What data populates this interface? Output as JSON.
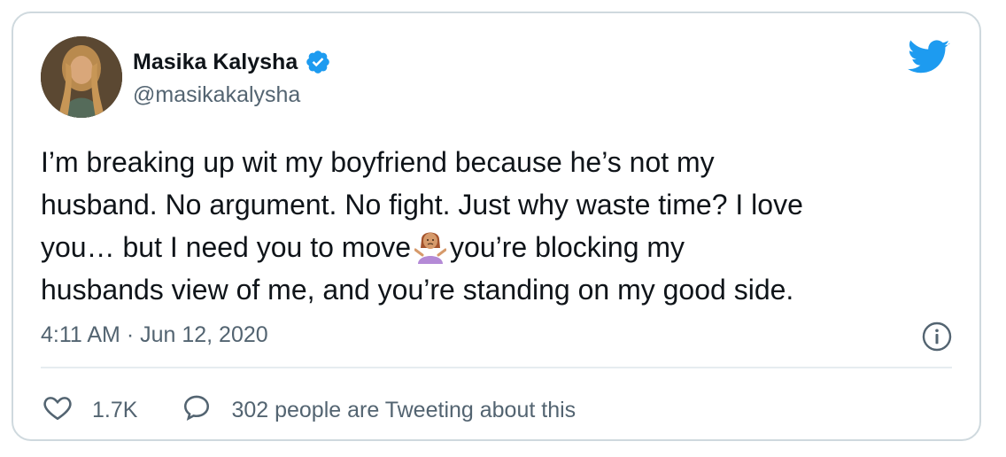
{
  "tweet": {
    "author": {
      "display_name": "Masika Kalysha",
      "handle": "@masikakalysha",
      "verified": true
    },
    "text_lines": [
      "I’m breaking up wit my boyfriend because he’s not my",
      "husband. No argument. No fight. Just why waste time? I love",
      "you… but I need you to move",
      "you’re blocking my",
      "husbands view of me, and you’re standing on my good side."
    ],
    "emoji": "person-shrugging-emoji",
    "timestamp": "4:11 AM · Jun 12, 2020",
    "likes": "1.7K",
    "tweeting_about": "302 people are Tweeting about this"
  },
  "icons": {
    "brand": "twitter-bird-icon",
    "verified": "verified-badge-icon",
    "info": "info-icon",
    "like": "heart-icon",
    "reply": "speech-bubble-icon"
  },
  "colors": {
    "brand_blue": "#1d9bf0",
    "text_primary": "#0f1419",
    "text_secondary": "#536471",
    "border": "#cfd9de"
  }
}
